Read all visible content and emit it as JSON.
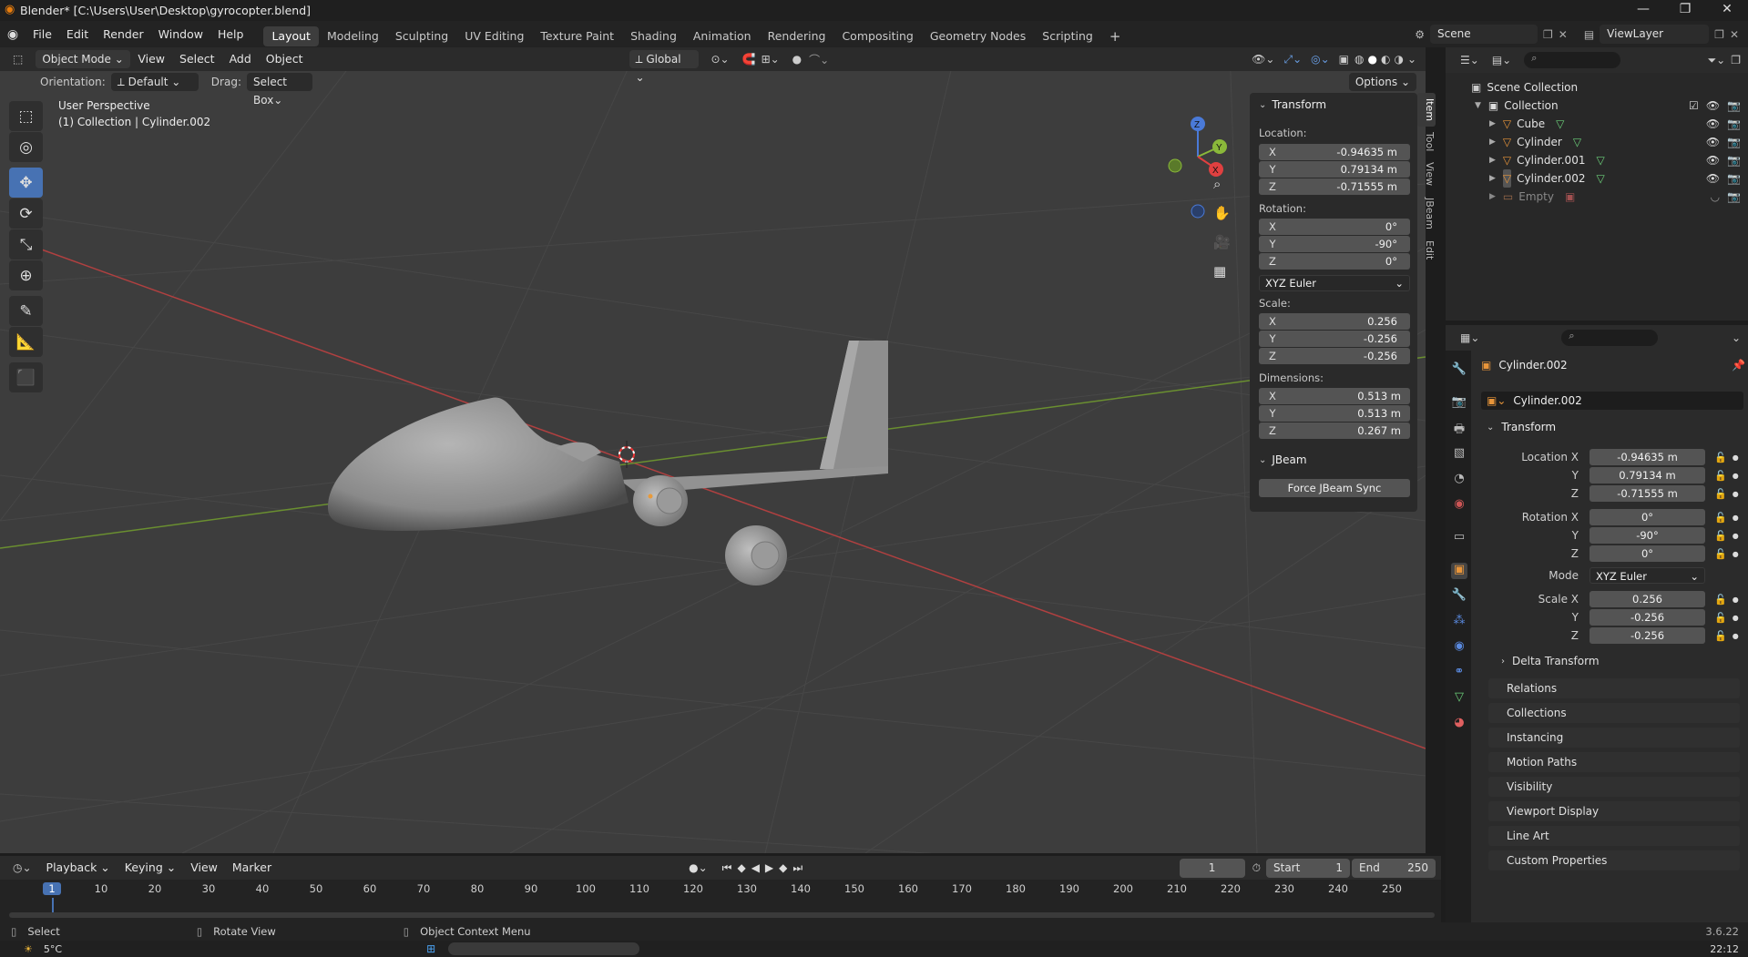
{
  "titlebar": {
    "title": "Blender* [C:\\Users\\User\\Desktop\\gyrocopter.blend]",
    "min": "—",
    "max": "❐",
    "close": "✕"
  },
  "menus": [
    "File",
    "Edit",
    "Render",
    "Window",
    "Help"
  ],
  "workspaces": [
    "Layout",
    "Modeling",
    "Sculpting",
    "UV Editing",
    "Texture Paint",
    "Shading",
    "Animation",
    "Rendering",
    "Compositing",
    "Geometry Nodes",
    "Scripting"
  ],
  "active_workspace": "Layout",
  "scene": {
    "scene_label": "Scene",
    "viewlayer_label": "ViewLayer"
  },
  "viewport_header": {
    "mode": "Object Mode",
    "menus": [
      "View",
      "Select",
      "Add",
      "Object"
    ],
    "transform_orientation": "Global",
    "orientation_label": "Orientation:",
    "orientation_value": "Default",
    "drag_label": "Drag:",
    "drag_value": "Select Box",
    "options": "Options"
  },
  "viewport": {
    "perspective": "User Perspective",
    "collection_info": "(1) Collection | Cylinder.002"
  },
  "gizmo": {
    "z": "Z",
    "y": "Y",
    "x": "X"
  },
  "npanel": {
    "tabs": [
      "Item",
      "Tool",
      "View",
      "JBeam",
      "Edit"
    ],
    "transform_header": "Transform",
    "location_label": "Location:",
    "location": [
      {
        "axis": "X",
        "value": "-0.94635 m"
      },
      {
        "axis": "Y",
        "value": "0.79134 m"
      },
      {
        "axis": "Z",
        "value": "-0.71555 m"
      }
    ],
    "rotation_label": "Rotation:",
    "rotation": [
      {
        "axis": "X",
        "value": "0°"
      },
      {
        "axis": "Y",
        "value": "-90°"
      },
      {
        "axis": "Z",
        "value": "0°"
      }
    ],
    "rotation_mode": "XYZ Euler",
    "scale_label": "Scale:",
    "scale": [
      {
        "axis": "X",
        "value": "0.256"
      },
      {
        "axis": "Y",
        "value": "-0.256"
      },
      {
        "axis": "Z",
        "value": "-0.256"
      }
    ],
    "dimensions_label": "Dimensions:",
    "dimensions": [
      {
        "axis": "X",
        "value": "0.513 m"
      },
      {
        "axis": "Y",
        "value": "0.513 m"
      },
      {
        "axis": "Z",
        "value": "0.267 m"
      }
    ],
    "jbeam_header": "JBeam",
    "force_sync": "Force JBeam Sync"
  },
  "outliner": {
    "scene_collection": "Scene Collection",
    "collection": "Collection",
    "items": [
      "Cube",
      "Cylinder",
      "Cylinder.001",
      "Cylinder.002",
      "Empty"
    ]
  },
  "properties": {
    "object_name": "Cylinder.002",
    "datablock": "Cylinder.002",
    "transform_header": "Transform",
    "location_labels": [
      "Location X",
      "Y",
      "Z"
    ],
    "location": [
      "-0.94635 m",
      "0.79134 m",
      "-0.71555 m"
    ],
    "rotation_labels": [
      "Rotation X",
      "Y",
      "Z"
    ],
    "rotation": [
      "0°",
      "-90°",
      "0°"
    ],
    "mode_label": "Mode",
    "mode": "XYZ Euler",
    "scale_labels": [
      "Scale X",
      "Y",
      "Z"
    ],
    "scale": [
      "0.256",
      "-0.256",
      "-0.256"
    ],
    "delta": "Delta Transform",
    "sections": [
      "Relations",
      "Collections",
      "Instancing",
      "Motion Paths",
      "Visibility",
      "Viewport Display",
      "Line Art",
      "Custom Properties"
    ]
  },
  "timeline": {
    "menus": [
      "Playback",
      "Keying",
      "View",
      "Marker"
    ],
    "current_frame": "1",
    "start_label": "Start",
    "start": "1",
    "end_label": "End",
    "end": "250",
    "ticks": [
      "1",
      "10",
      "20",
      "30",
      "40",
      "50",
      "60",
      "70",
      "80",
      "90",
      "100",
      "110",
      "120",
      "130",
      "140",
      "150",
      "160",
      "170",
      "180",
      "190",
      "200",
      "210",
      "220",
      "230",
      "240",
      "250"
    ]
  },
  "status": {
    "select": "Select",
    "rotate": "Rotate View",
    "context": "Object Context Menu",
    "version": "3.6.22"
  },
  "taskbar": {
    "temp": "5°C",
    "time": "22:12"
  }
}
